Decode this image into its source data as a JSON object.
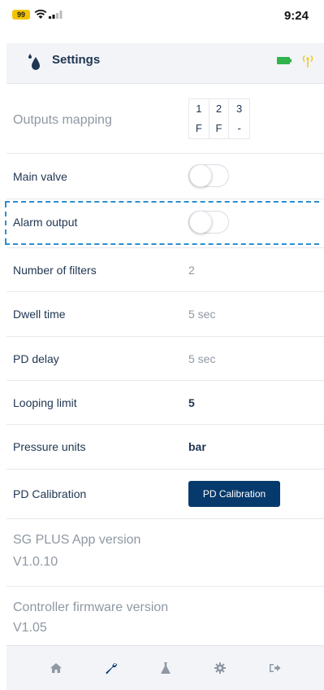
{
  "status_bar": {
    "battery_level": "99",
    "time": "9:24"
  },
  "header": {
    "title": "Settings"
  },
  "colors": {
    "primary": "#073a6c",
    "text": "#1f3552",
    "muted": "#8f98a3",
    "highlight": "#2a8fd1",
    "battery": "#2fb34a",
    "antenna": "#f4c400"
  },
  "settings": {
    "outputs_mapping": {
      "label": "Outputs mapping",
      "numbers": [
        "1",
        "2",
        "3"
      ],
      "modes": [
        "F",
        "F",
        "-"
      ]
    },
    "main_valve": {
      "label": "Main valve",
      "on": false
    },
    "alarm_output": {
      "label": "Alarm output",
      "on": false
    },
    "number_of_filters": {
      "label": "Number of filters",
      "value": "2"
    },
    "dwell_time": {
      "label": "Dwell time",
      "value": "5 sec"
    },
    "pd_delay": {
      "label": "PD delay",
      "value": "5 sec"
    },
    "looping_limit": {
      "label": "Looping limit",
      "value": "5"
    },
    "pressure_units": {
      "label": "Pressure units",
      "value": "bar"
    },
    "pd_calibration": {
      "label": "PD Calibration",
      "button_label": "PD Calibration"
    },
    "app_version": {
      "label": "SG PLUS App version",
      "value": "V1.0.10"
    },
    "firmware_version": {
      "label": "Controller firmware version",
      "value": "V1.05"
    }
  },
  "nav": {
    "items": [
      {
        "icon": "home-icon",
        "active": false
      },
      {
        "icon": "wrench-icon",
        "active": true
      },
      {
        "icon": "flask-icon",
        "active": false
      },
      {
        "icon": "gear-icon",
        "active": false
      },
      {
        "icon": "logout-icon",
        "active": false
      }
    ]
  }
}
